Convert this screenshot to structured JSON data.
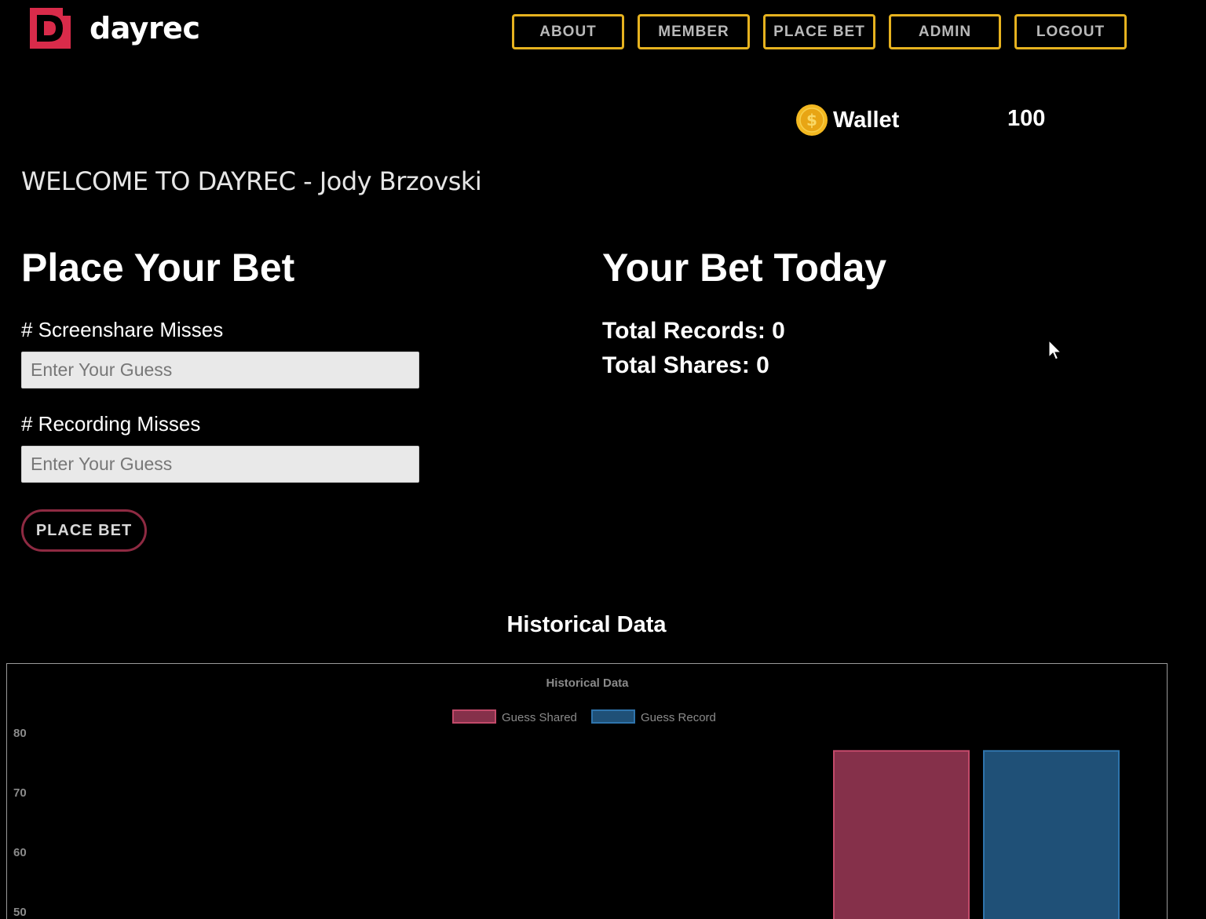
{
  "header": {
    "logo_text": "dayrec",
    "nav": [
      {
        "label": "ABOUT",
        "name": "nav-about-button"
      },
      {
        "label": "MEMBER",
        "name": "nav-member-button"
      },
      {
        "label": "PLACE BET",
        "name": "nav-place-bet-button"
      },
      {
        "label": "ADMIN",
        "name": "nav-admin-button"
      },
      {
        "label": "LOGOUT",
        "name": "nav-logout-button"
      }
    ],
    "brand_color": "#d92b4a",
    "nav_border_color": "#e6b21f"
  },
  "wallet": {
    "icon": "coin-icon",
    "label": "Wallet",
    "value": "100"
  },
  "welcome": "WELCOME TO DAYREC - Jody Brzovski",
  "place_bet": {
    "title": "Place Your Bet",
    "screenshare_label": "# Screenshare Misses",
    "screenshare_placeholder": "Enter Your Guess",
    "recording_label": "# Recording Misses",
    "recording_placeholder": "Enter Your Guess",
    "button_label": "PLACE BET"
  },
  "bet_today": {
    "title": "Your Bet Today",
    "total_records": "Total Records: 0",
    "total_shares": "Total Shares: 0"
  },
  "chart_section": {
    "heading": "Historical Data"
  },
  "chart_data": {
    "type": "bar",
    "title": "Historical Data",
    "legend_position": "top-center",
    "series": [
      {
        "name": "Guess Shared",
        "color": "#85304a",
        "border": "#c24a6a",
        "values": [
          77
        ]
      },
      {
        "name": "Guess Record",
        "color": "#1f5077",
        "border": "#2f74ac",
        "values": [
          77
        ]
      }
    ],
    "y_ticks": [
      "80",
      "70",
      "60",
      "50"
    ],
    "ylim_visible": [
      50,
      80
    ],
    "grid": false
  }
}
